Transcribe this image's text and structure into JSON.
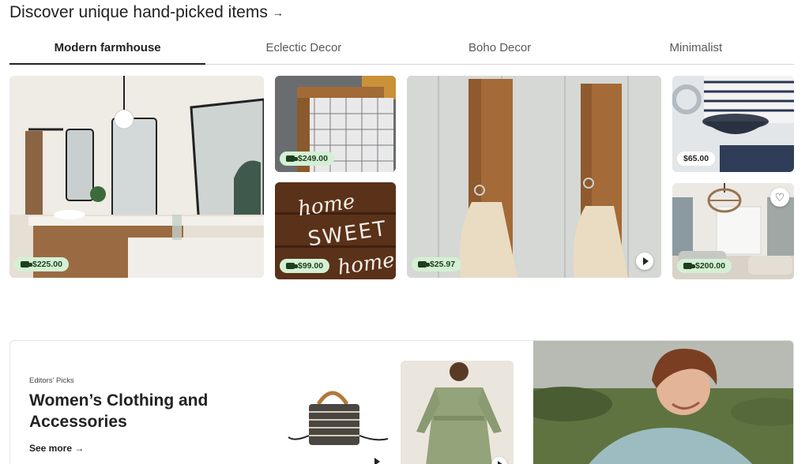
{
  "header": {
    "title": "Discover unique hand-picked items",
    "arrow": "→"
  },
  "tabs": [
    {
      "label": "Modern farmhouse",
      "active": true
    },
    {
      "label": "Eclectic Decor",
      "active": false
    },
    {
      "label": "Boho Decor",
      "active": false
    },
    {
      "label": "Minimalist",
      "active": false
    }
  ],
  "tiles": [
    {
      "price": "$225.00",
      "free_shipping": true
    },
    {
      "price": "$249.00",
      "free_shipping": true
    },
    {
      "price": "$99.00",
      "free_shipping": true,
      "sign_text": "home SWEET home"
    },
    {
      "price": "$25.97",
      "free_shipping": true,
      "video": true
    },
    {
      "price": "$65.00",
      "free_shipping": false
    },
    {
      "price": "$200.00",
      "free_shipping": true,
      "favorite": true
    }
  ],
  "editors_picks": {
    "eyebrow": "Editors' Picks",
    "title": "Women’s Clothing and Accessories",
    "see_more": "See more",
    "arrow": "→"
  },
  "colors": {
    "price_badge_bg": "#d4f0d4",
    "active_tab_underline": "#222222"
  }
}
